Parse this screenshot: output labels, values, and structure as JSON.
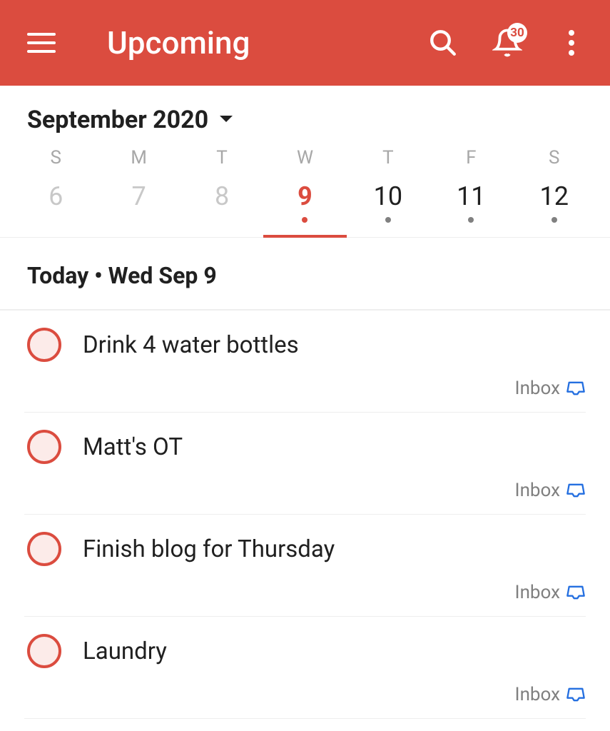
{
  "header": {
    "title": "Upcoming",
    "notification_count": "30"
  },
  "month": {
    "label": "September 2020",
    "days": [
      {
        "letter": "S",
        "num": "6",
        "past": true,
        "selected": false,
        "dot": false
      },
      {
        "letter": "M",
        "num": "7",
        "past": true,
        "selected": false,
        "dot": false
      },
      {
        "letter": "T",
        "num": "8",
        "past": true,
        "selected": false,
        "dot": false
      },
      {
        "letter": "W",
        "num": "9",
        "past": false,
        "selected": true,
        "dot": true
      },
      {
        "letter": "T",
        "num": "10",
        "past": false,
        "selected": false,
        "dot": true
      },
      {
        "letter": "F",
        "num": "11",
        "past": false,
        "selected": false,
        "dot": true
      },
      {
        "letter": "S",
        "num": "12",
        "past": false,
        "selected": false,
        "dot": true
      }
    ]
  },
  "section": {
    "label": "Today  •  Wed Sep 9"
  },
  "tasks": [
    {
      "title": "Drink 4 water bottles",
      "project": "Inbox"
    },
    {
      "title": "Matt's OT",
      "project": "Inbox"
    },
    {
      "title": "Finish blog for Thursday",
      "project": "Inbox"
    },
    {
      "title": "Laundry",
      "project": "Inbox"
    }
  ]
}
